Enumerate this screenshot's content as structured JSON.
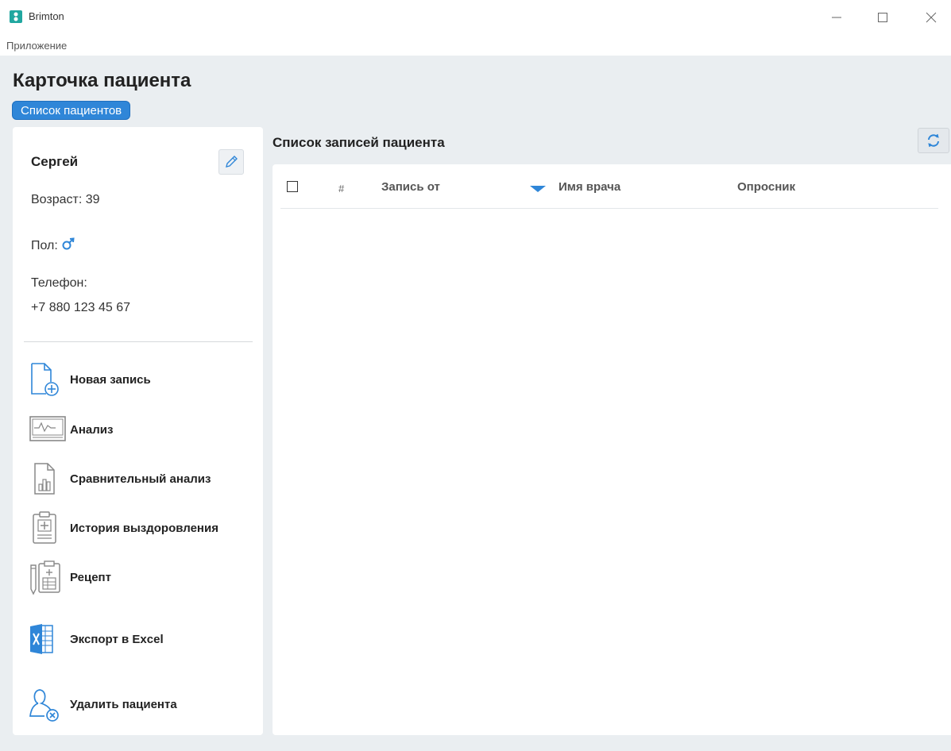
{
  "window": {
    "title": "Brimton",
    "menu": [
      "Приложение"
    ]
  },
  "page": {
    "title": "Карточка пациента",
    "back_button": "Список пациентов"
  },
  "patient": {
    "name": "Сергей",
    "age_label": "Возраст:",
    "age": "39",
    "sex_label": "Пол:",
    "sex_icon": "male-icon",
    "phone_label": "Телефон:",
    "phone": "+7 880 123 45 67"
  },
  "actions": [
    {
      "label": "Новая запись",
      "icon": "new-record-icon"
    },
    {
      "label": "Анализ",
      "icon": "analysis-icon"
    },
    {
      "label": "Сравнительный анализ",
      "icon": "comparative-analysis-icon"
    },
    {
      "label": "История выздоровления",
      "icon": "recovery-history-icon"
    },
    {
      "label": "Рецепт",
      "icon": "prescription-icon"
    },
    {
      "label": "Экспорт в Excel",
      "icon": "excel-icon"
    },
    {
      "label": "Удалить пациента",
      "icon": "delete-patient-icon"
    }
  ],
  "records": {
    "title": "Список записей пациента",
    "columns": [
      "#",
      "Запись от",
      "Имя врача",
      "Опросник"
    ],
    "rows": []
  },
  "colors": {
    "accent": "#2f86d8",
    "background": "#eaeef1"
  }
}
